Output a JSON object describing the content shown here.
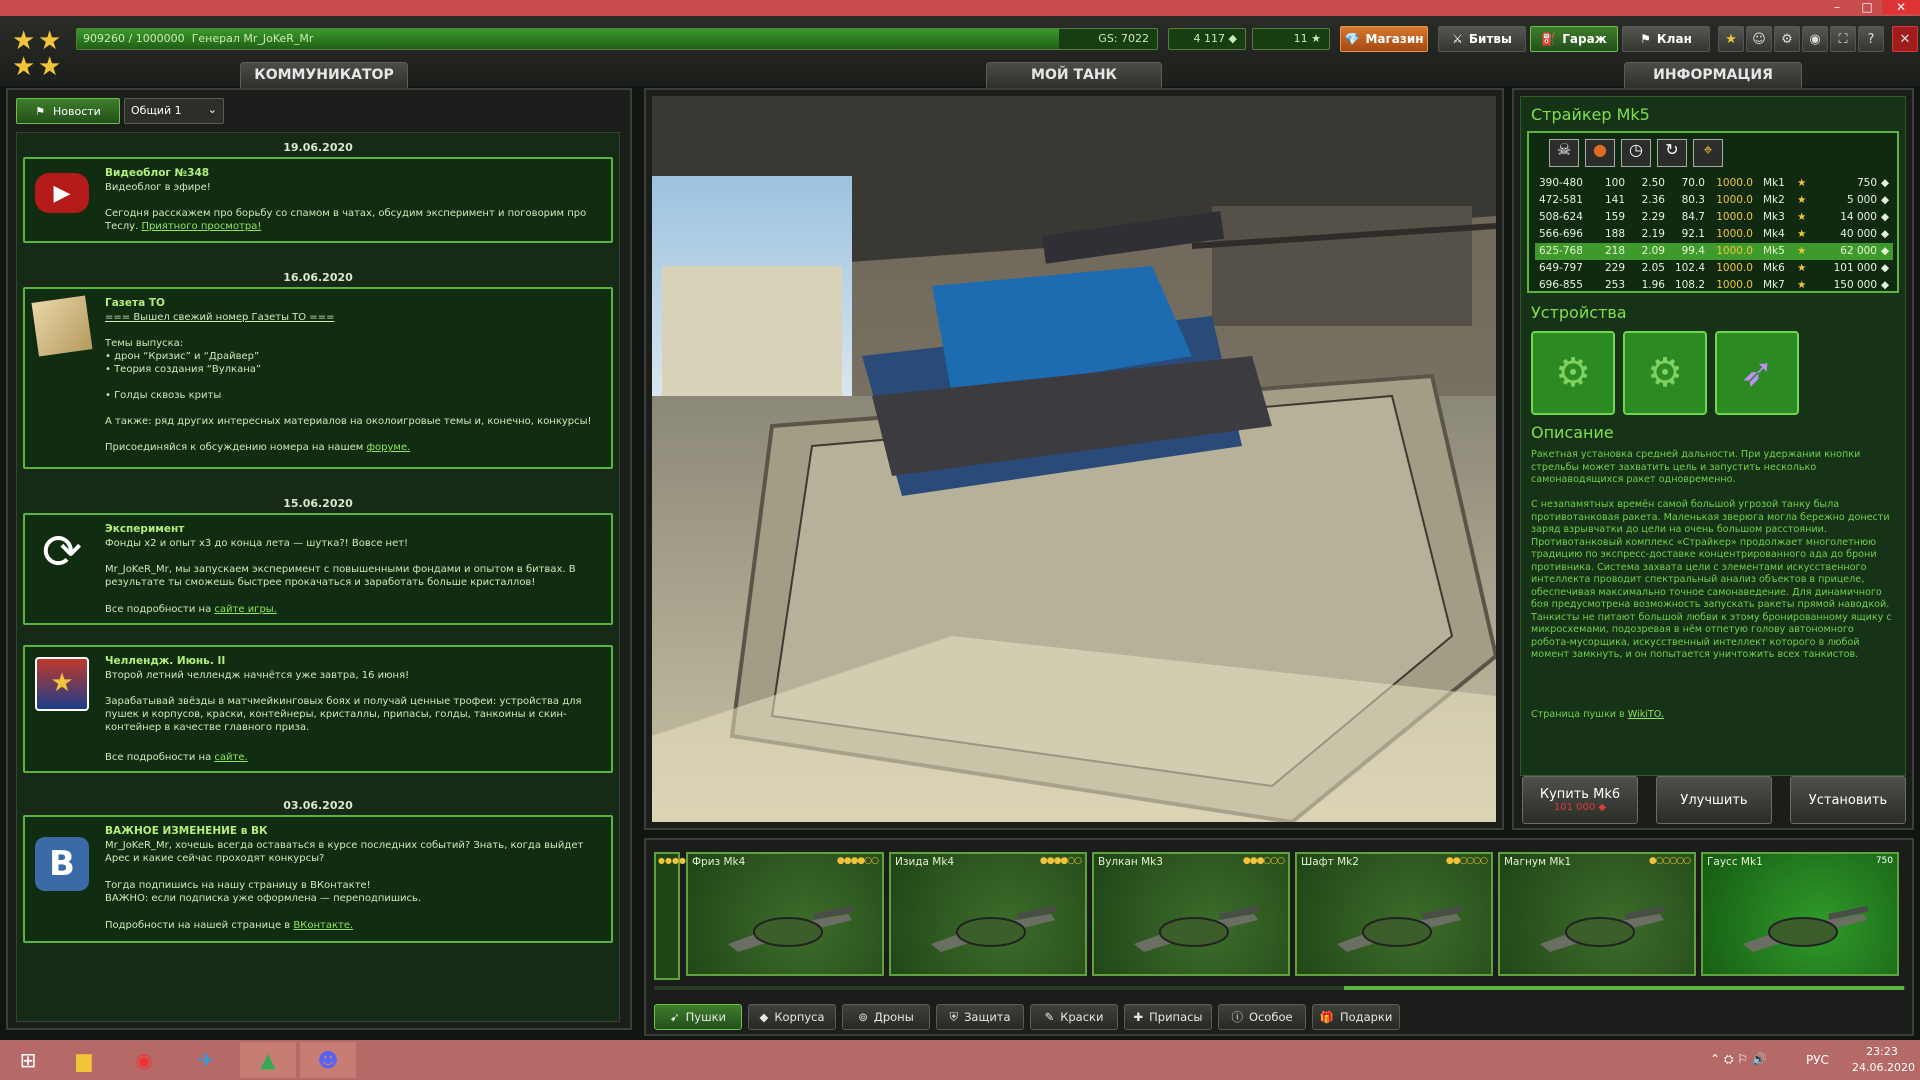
{
  "top": {
    "xp_text": "909260 / 1000000",
    "player": "Генерал Mr_JoKeR_Mr",
    "gs": "GS: 7022",
    "xp_progress": 0.909,
    "crystals": "4 117",
    "stars": "11",
    "buttons": {
      "shop": "Магазин",
      "battles": "Битвы",
      "garage": "Гараж",
      "clan": "Клан"
    },
    "close_label": "✕",
    "min_label": "–",
    "max_label": "□"
  },
  "comm": {
    "tab_title": "КОММУНИКАТОР",
    "news_btn": "Новости",
    "channel_select": "Общий 1",
    "dates": [
      "19.06.2020",
      "16.06.2020",
      "15.06.2020",
      "03.06.2020"
    ],
    "items": [
      {
        "title": "Видеоблог №348",
        "lines": [
          "Видеоблог в эфире!",
          "",
          "Сегодня расскажем про борьбу со спамом в чатах, обсудим эксперимент и поговорим про Теслу."
        ],
        "link_text": "Приятного просмотра!"
      },
      {
        "title": "Газета ТО",
        "link_top": "=== Вышел свежий номер Газеты ТО ===",
        "lines": [
          "Темы выпуска:",
          "• дрон “Кризис” и “Драйвер”",
          "• Теория создания “Вулкана”",
          "",
          "• Голды сквозь криты",
          "",
          "А также: ряд других интересных материалов на околоигровые темы и, конечно, конкурсы!",
          ""
        ],
        "link_pre": "Присоединяйся к обсуждению номера на нашем",
        "link_text": "форуме."
      },
      {
        "title": "Эксперимент",
        "lines": [
          "Фонды x2 и опыт x3 до конца лета — шутка?! Вовсе нет!",
          "",
          "Mr_JoKeR_Mr, мы запускаем эксперимент с повышенными фондами и опытом в битвах. В результате ты сможешь быстрее прокачаться и заработать больше кристаллов!",
          ""
        ],
        "link_pre": "Все подробности на",
        "link_text": "сайте игры."
      },
      {
        "title": "Челлендж. Июнь. II",
        "lines": [
          "Второй летний челлендж начнётся уже завтра, 16 июня!",
          "",
          "Зарабатывай звёзды в матчмейкинговых боях и получай ценные трофеи: устройства для пушек и корпусов, краски, контейнеры, кристаллы, припасы, голды, танкоины и скин-контейнер в качестве главного приза.",
          ""
        ],
        "link_pre": "Все подробности на",
        "link_text": "сайте."
      },
      {
        "title": "ВАЖНОЕ ИЗМЕНЕНИЕ в ВК",
        "lines": [
          "Mr_JoKeR_Mr, хочешь всегда оставаться в курсе последних событий? Знать, когда выйдет Арес и какие сейчас проходят конкурсы?",
          "",
          "Тогда подпишись на нашу страницу в ВКонтакте!",
          "ВАЖНО: если подписка уже оформлена — переподпишись.",
          ""
        ],
        "link_pre": "Подробности на нашей странице в",
        "link_text": "ВКонтакте."
      }
    ]
  },
  "tank": {
    "tab_title": "МОЙ ТАНК"
  },
  "info": {
    "tab_title": "ИНФОРМАЦИЯ",
    "item_name": "Страйкер Mk5",
    "rows": [
      {
        "c1": "390-480",
        "c2": "100",
        "c3": "2.50",
        "c4": "70.0",
        "c5": "1000.0",
        "mk": "Mk1",
        "price": "750"
      },
      {
        "c1": "472-581",
        "c2": "141",
        "c3": "2.36",
        "c4": "80.3",
        "c5": "1000.0",
        "mk": "Mk2",
        "price": "5 000"
      },
      {
        "c1": "508-624",
        "c2": "159",
        "c3": "2.29",
        "c4": "84.7",
        "c5": "1000.0",
        "mk": "Mk3",
        "price": "14 000"
      },
      {
        "c1": "566-696",
        "c2": "188",
        "c3": "2.19",
        "c4": "92.1",
        "c5": "1000.0",
        "mk": "Mk4",
        "price": "40 000"
      },
      {
        "c1": "625-768",
        "c2": "218",
        "c3": "2.09",
        "c4": "99.4",
        "c5": "1000.0",
        "mk": "Mk5",
        "price": "62 000"
      },
      {
        "c1": "649-797",
        "c2": "229",
        "c3": "2.05",
        "c4": "102.4",
        "c5": "1000.0",
        "mk": "Mk6",
        "price": "101 000"
      },
      {
        "c1": "696-855",
        "c2": "253",
        "c3": "1.96",
        "c4": "108.2",
        "c5": "1000.0",
        "mk": "Mk7",
        "price": "150 000"
      }
    ],
    "selected_row": 4,
    "devices_title": "Устройства",
    "desc_title": "Описание",
    "desc_p1": "Ракетная установка средней дальности. При удержании кнопки стрельбы может захватить цель и запустить несколько самонаводящихся ракет одновременно.",
    "desc_p2": "С незапамятных времён самой большой угрозой танку была противотанковая ракета. Маленькая зверюга могла бережно донести заряд взрывчатки до цели на очень большом расстоянии. Противотанковый комплекс «Страйкер» продолжает многолетнюю традицию по экспресс-доставке концентрированного ада до брони противника. Система захвата цели с элементами искусственного интеллекта проводит спектральный анализ объектов в прицеле, обеспечивая максимально точное самонаведение. Для динамичного боя предусмотрена возможность запускать ракеты прямой наводкой. Танкисты не питают большой любви к этому бронированному ящику с микросхемами, подозревая в нём отпетую голову автономного робота-мусорщика, искусственный интеллект которого в любой момент замкнуть, и он попытается уничтожить всех танкистов.",
    "wiki_pre": "Страница пушки в",
    "wiki_link": "WikiTO.",
    "buy_label": "Купить Mk6",
    "buy_price": "101 000",
    "upgrade_label": "Улучшить",
    "install_label": "Установить"
  },
  "garage": {
    "cards": [
      {
        "name": "Фриз Mk4",
        "stars": "●●●●○○"
      },
      {
        "name": "Изида Mk4",
        "stars": "●●●●○○"
      },
      {
        "name": "Вулкан Mk3",
        "stars": "●●●○○○"
      },
      {
        "name": "Шафт Mk2",
        "stars": "●●○○○○"
      },
      {
        "name": "Магнум Mk1",
        "stars": "●○○○○○"
      },
      {
        "name": "Гаусс Mk1",
        "stars": "750"
      }
    ],
    "tabs": [
      "Пушки",
      "Корпуса",
      "Дроны",
      "Защита",
      "Краски",
      "Припасы",
      "Особое",
      "Подарки"
    ]
  },
  "taskbar": {
    "lang": "РУС",
    "time": "23:23",
    "date": "24.06.2020"
  },
  "colors": {
    "accent": "#5bb43e",
    "selected_row": "#3f9a2c",
    "taskbar": "#b66a68",
    "titlebar": "#c94d4d"
  }
}
